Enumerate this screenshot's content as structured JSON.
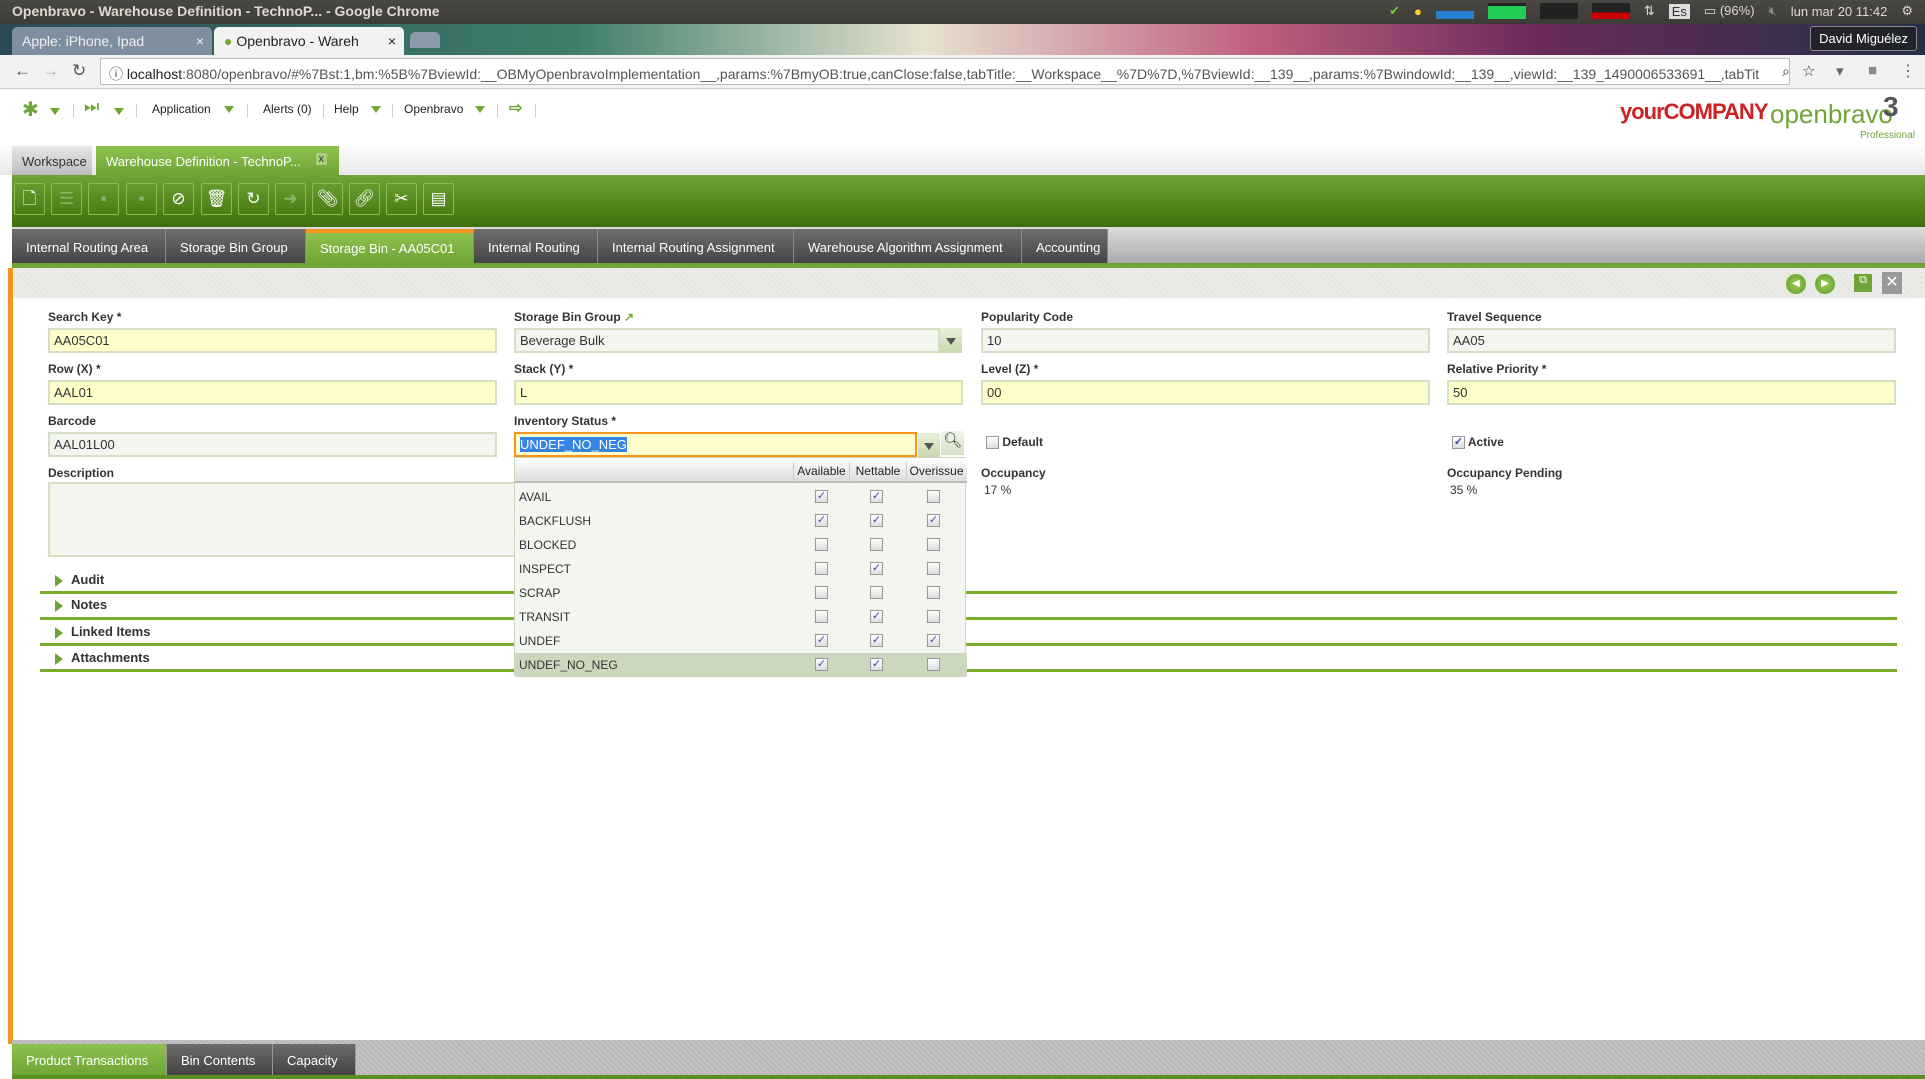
{
  "os": {
    "title": "Openbravo - Warehouse Definition - TechnoP... - Google Chrome",
    "language": "Es",
    "battery": "(96%)",
    "clock": "lun mar 20 11:42"
  },
  "browser": {
    "tabs": [
      {
        "label": "Apple: iPhone, Ipad"
      },
      {
        "label": "Openbravo - Wareh"
      }
    ],
    "user": "David Miguélez",
    "url_host": "localhost",
    "url_rest": ":8080/openbravo/#%7Bst:1,bm:%5B%7BviewId:__OBMyOpenbravoImplementation__,params:%7BmyOB:true,canClose:false,tabTitle:__Workspace__%7D%7D,%7BviewId:__139__,params:%7BwindowId:__139__,viewId:__139_1490006533691__,tabTit"
  },
  "menu": {
    "application": "Application",
    "alerts": "Alerts (0)",
    "help": "Help",
    "openbravo": "Openbravo",
    "brand_company": "yourCOMPANY",
    "brand_product": "openbravo",
    "brand_edition": "Professional"
  },
  "window_tabs": [
    {
      "label": "Workspace"
    },
    {
      "label": "Warehouse Definition - TechnoP..."
    }
  ],
  "sub_tabs": [
    {
      "label": "Internal Routing Area"
    },
    {
      "label": "Storage Bin Group"
    },
    {
      "label": "Storage Bin - AA05C01"
    },
    {
      "label": "Internal Routing"
    },
    {
      "label": "Internal Routing Assignment"
    },
    {
      "label": "Warehouse Algorithm Assignment"
    },
    {
      "label": "Accounting"
    }
  ],
  "form": {
    "search_key": {
      "label": "Search Key *",
      "value": "AA05C01"
    },
    "storage_bin_group": {
      "label": "Storage Bin Group",
      "value": "Beverage Bulk"
    },
    "popularity_code": {
      "label": "Popularity Code",
      "value": "10"
    },
    "travel_sequence": {
      "label": "Travel Sequence",
      "value": "AA05"
    },
    "row": {
      "label": "Row (X) *",
      "value": "AAL01"
    },
    "stack": {
      "label": "Stack (Y) *",
      "value": "L"
    },
    "level": {
      "label": "Level (Z) *",
      "value": "00"
    },
    "relative_priority": {
      "label": "Relative Priority *",
      "value": "50"
    },
    "barcode": {
      "label": "Barcode",
      "value": "AAL01L00"
    },
    "inventory_status": {
      "label": "Inventory Status *",
      "value": "UNDEF_NO_NEG"
    },
    "default": {
      "label": "Default",
      "checked": false
    },
    "active": {
      "label": "Active",
      "checked": true
    },
    "description": {
      "label": "Description",
      "value": ""
    },
    "occupancy": {
      "label": "Occupancy",
      "value": "17 %"
    },
    "occupancy_pending": {
      "label": "Occupancy Pending",
      "value": "35 %"
    }
  },
  "dropdown": {
    "columns": [
      "Available",
      "Nettable",
      "Overissue"
    ],
    "rows": [
      {
        "name": "AVAIL",
        "available": true,
        "nettable": true,
        "overissue": false
      },
      {
        "name": "BACKFLUSH",
        "available": true,
        "nettable": true,
        "overissue": true
      },
      {
        "name": "BLOCKED",
        "available": false,
        "nettable": false,
        "overissue": false
      },
      {
        "name": "INSPECT",
        "available": false,
        "nettable": true,
        "overissue": false
      },
      {
        "name": "SCRAP",
        "available": false,
        "nettable": false,
        "overissue": false
      },
      {
        "name": "TRANSIT",
        "available": false,
        "nettable": true,
        "overissue": false
      },
      {
        "name": "UNDEF",
        "available": true,
        "nettable": true,
        "overissue": true
      },
      {
        "name": "UNDEF_NO_NEG",
        "available": true,
        "nettable": true,
        "overissue": false,
        "selected": true
      }
    ]
  },
  "sections": [
    {
      "label": "Audit"
    },
    {
      "label": "Notes"
    },
    {
      "label": "Linked Items"
    },
    {
      "label": "Attachments"
    }
  ],
  "bottom_tabs": [
    {
      "label": "Product Transactions"
    },
    {
      "label": "Bin Contents"
    },
    {
      "label": "Capacity"
    }
  ],
  "colors": {
    "accent": "#6ea536",
    "required": "#ffffcc",
    "active_tab_marker": "#f7941d"
  }
}
